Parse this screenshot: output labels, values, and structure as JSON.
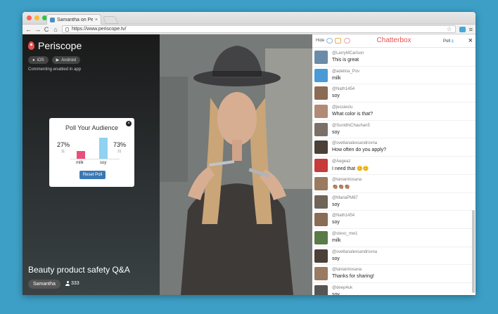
{
  "colors": {
    "brand": "#e94f4f",
    "button": "#3b78b4",
    "poll_milk": "#e94f7a",
    "poll_soy": "#8fd2f2"
  },
  "browser": {
    "tab_title": "Samantha on Periscope",
    "tab_close": "×",
    "url": "https://www.periscope.tv/",
    "nav_back": "←",
    "nav_forward": "→",
    "nav_reload": "C",
    "nav_home": "⌂",
    "star": "☆",
    "menu": "≡"
  },
  "sidebar": {
    "logo": "Periscope",
    "ios_label": "iOS",
    "android_label": "Android",
    "commenting": "Commenting enabled in app",
    "broadcast_title": "Beauty product safety Q&A",
    "username": "Samantha",
    "viewers": "333"
  },
  "poll": {
    "title": "Poll Your Audience",
    "close": "×",
    "reset_label": "Reset Poll",
    "options": [
      {
        "label": "milk",
        "percent_label": "27%",
        "count": "11",
        "share": 0.27
      },
      {
        "label": "soy",
        "percent_label": "73%",
        "count": "31",
        "share": 0.73
      }
    ]
  },
  "chat": {
    "hide_label": "Hide",
    "title": "Chatterbox",
    "poll_label": "Poll",
    "close": "×",
    "messages": [
      {
        "user": "@LarryMCarlson",
        "text": "This is great",
        "avatar_color": "#6a8ca8"
      },
      {
        "user": "@adelina_Pov",
        "text": "milk",
        "avatar_color": "#4a9ad8"
      },
      {
        "user": "@Nath1454",
        "text": "soy",
        "avatar_color": "#8a6b55"
      },
      {
        "user": "@jessieclu",
        "text": "What color is that?",
        "avatar_color": "#b08a76"
      },
      {
        "user": "@SunidhiChauhan5",
        "text": "soy",
        "avatar_color": "#7a7068"
      },
      {
        "user": "@svetlanalexsandrovna",
        "text": "How often do you apply?",
        "avatar_color": "#4a4038"
      },
      {
        "user": "@Aegeaz",
        "text": "I need that 😊😊",
        "avatar_color": "#c83b3b"
      },
      {
        "user": "@tanianirosana",
        "text": "👏🏽👏🏽👏🏽",
        "avatar_color": "#9a7a60"
      },
      {
        "user": "@MariaPM87",
        "text": "soy",
        "avatar_color": "#6f6458"
      },
      {
        "user": "@Nath1454",
        "text": "soy",
        "avatar_color": "#8a6b55"
      },
      {
        "user": "@stevo_mw1",
        "text": "milk",
        "avatar_color": "#5a7a46"
      },
      {
        "user": "@svetlanalexsandrovna",
        "text": "soy",
        "avatar_color": "#4a4038"
      },
      {
        "user": "@tanianirosana",
        "text": "Thanks for sharing!",
        "avatar_color": "#9a7a60"
      },
      {
        "user": "@deep4uk",
        "text": "soy",
        "avatar_color": "#555555"
      }
    ]
  }
}
